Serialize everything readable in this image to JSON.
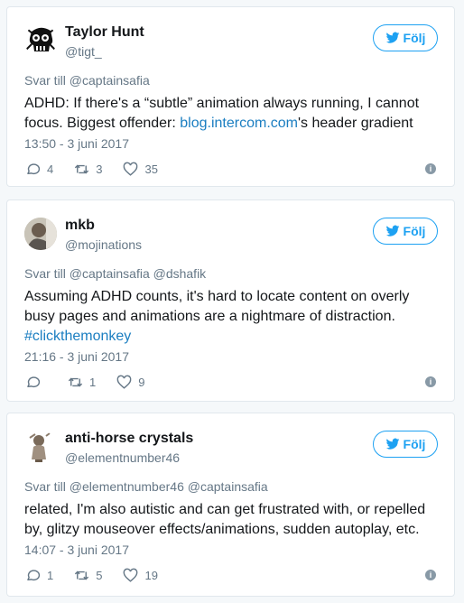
{
  "colors": {
    "accent": "#1da1f2",
    "link": "#1b7ec1",
    "muted": "#657786"
  },
  "follow_label": "Följ",
  "tweets": [
    {
      "name": "Taylor Hunt",
      "handle": "@tigt_",
      "reply_prefix": "Svar till",
      "reply_to": "@captainsafia",
      "text_before": "ADHD: If there's a “subtle” animation always running, I cannot focus. Biggest offender: ",
      "link": "blog.intercom.com",
      "text_after": "'s header gradient",
      "timestamp": "13:50 - 3 juni 2017",
      "replies": "4",
      "retweets": "3",
      "likes": "35"
    },
    {
      "name": "mkb",
      "handle": "@mojinations",
      "reply_prefix": "Svar till",
      "reply_to": "@captainsafia @dshafik",
      "text": "Assuming ADHD counts, it's hard to locate content on overly busy pages and animations are a nightmare of distraction.",
      "hashtag": "#clickthemonkey",
      "timestamp": "21:16 - 3 juni 2017",
      "replies": "",
      "retweets": "1",
      "likes": "9"
    },
    {
      "name": "anti-horse crystals",
      "handle": "@elementnumber46",
      "reply_prefix": "Svar till",
      "reply_to": "@elementnumber46 @captainsafia",
      "text": "related, I'm also autistic and can get frustrated with, or repelled by, glitzy mouseover effects/animations, sudden autoplay, etc.",
      "timestamp": "14:07 - 3 juni 2017",
      "replies": "1",
      "retweets": "5",
      "likes": "19"
    }
  ],
  "icons": [
    "skull-avatar-icon",
    "bird-icon",
    "reply-icon",
    "retweet-icon",
    "heart-icon",
    "info-icon"
  ]
}
